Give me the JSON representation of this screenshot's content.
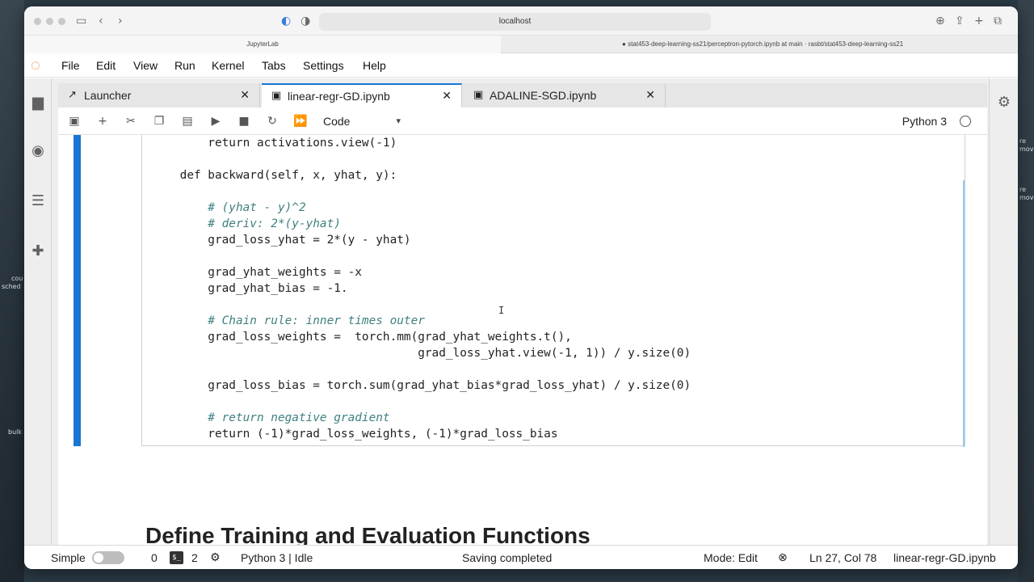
{
  "browser": {
    "url": "localhost",
    "tabs": [
      {
        "label": "JupyterLab"
      },
      {
        "label": "stat453-deep-learning-ss21/perceptron-pytorch.ipynb at main · rasbt/stat453-deep-learning-ss21"
      }
    ]
  },
  "menu": {
    "items": [
      "File",
      "Edit",
      "View",
      "Run",
      "Kernel",
      "Tabs",
      "Settings",
      "Help"
    ]
  },
  "doc_tabs": [
    {
      "label": "Launcher"
    },
    {
      "label": "linear-regr-GD.ipynb"
    },
    {
      "label": "ADALINE-SGD.ipynb"
    }
  ],
  "toolbar": {
    "cell_type": "Code",
    "kernel": "Python 3"
  },
  "code": {
    "lines": [
      "        return activations.view(-1)",
      "",
      "    def backward(self, x, yhat, y):",
      "",
      "        # (yhat - y)^2",
      "        # deriv: 2*(y-yhat)",
      "        grad_loss_yhat = 2*(y - yhat)",
      "",
      "        grad_yhat_weights = -x",
      "        grad_yhat_bias = -1.",
      "",
      "        # Chain rule: inner times outer",
      "        grad_loss_weights =  torch.mm(grad_yhat_weights.t(),",
      "                                      grad_loss_yhat.view(-1, 1)) / y.size(0)",
      "",
      "        grad_loss_bias = torch.sum(grad_yhat_bias*grad_loss_yhat) / y.size(0)",
      "",
      "        # return negative gradient",
      "        return (-1)*grad_loss_weights, (-1)*grad_loss_bias"
    ]
  },
  "markdown": {
    "heading": "Define Training and Evaluation Functions"
  },
  "status": {
    "mode_label": "Simple",
    "count_a": "0",
    "count_b": "2",
    "kernel_status": "Python 3 | Idle",
    "save_status": "Saving completed",
    "edit_mode": "Mode: Edit",
    "position": "Ln 27, Col 78",
    "filename": "linear-regr-GD.ipynb"
  },
  "desktop": {
    "labels": [
      "cou",
      "sched",
      "bulk",
      "re",
      "mov"
    ]
  }
}
